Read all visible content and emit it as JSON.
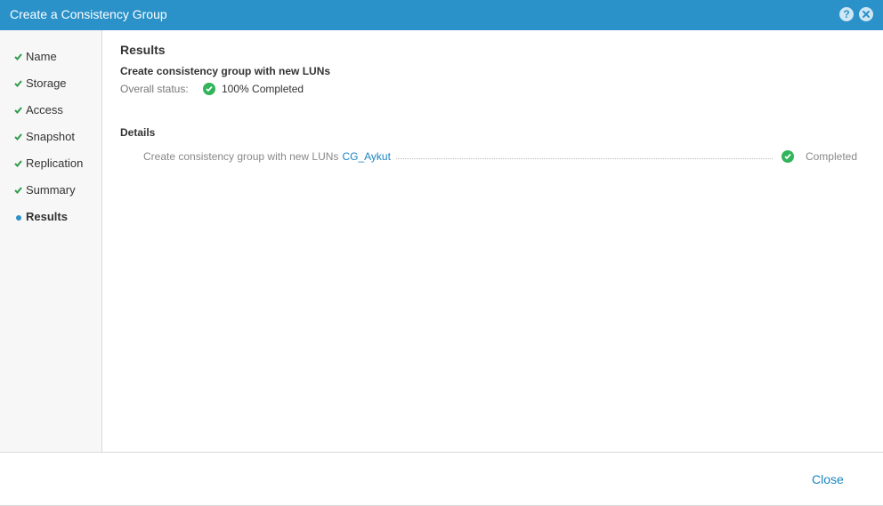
{
  "window": {
    "title": "Create a Consistency Group",
    "help_icon": "?",
    "close_icon_name": "close-icon"
  },
  "steps": [
    {
      "label": "Name",
      "state": "done"
    },
    {
      "label": "Storage",
      "state": "done"
    },
    {
      "label": "Access",
      "state": "done"
    },
    {
      "label": "Snapshot",
      "state": "done"
    },
    {
      "label": "Replication",
      "state": "done"
    },
    {
      "label": "Summary",
      "state": "done"
    },
    {
      "label": "Results",
      "state": "current"
    }
  ],
  "results": {
    "heading": "Results",
    "subheading": "Create consistency group with new LUNs",
    "overall_status_label": "Overall status:",
    "overall_status_value": "100% Completed",
    "details_title": "Details",
    "detail_rows": [
      {
        "text": "Create consistency group with new LUNs",
        "link": "CG_Aykut",
        "status": "Completed"
      }
    ]
  },
  "footer": {
    "close_label": "Close"
  },
  "colors": {
    "title_bar": "#2a91c9",
    "success": "#31b45a",
    "check": "#2d9c4a",
    "link": "#1a85c1"
  }
}
